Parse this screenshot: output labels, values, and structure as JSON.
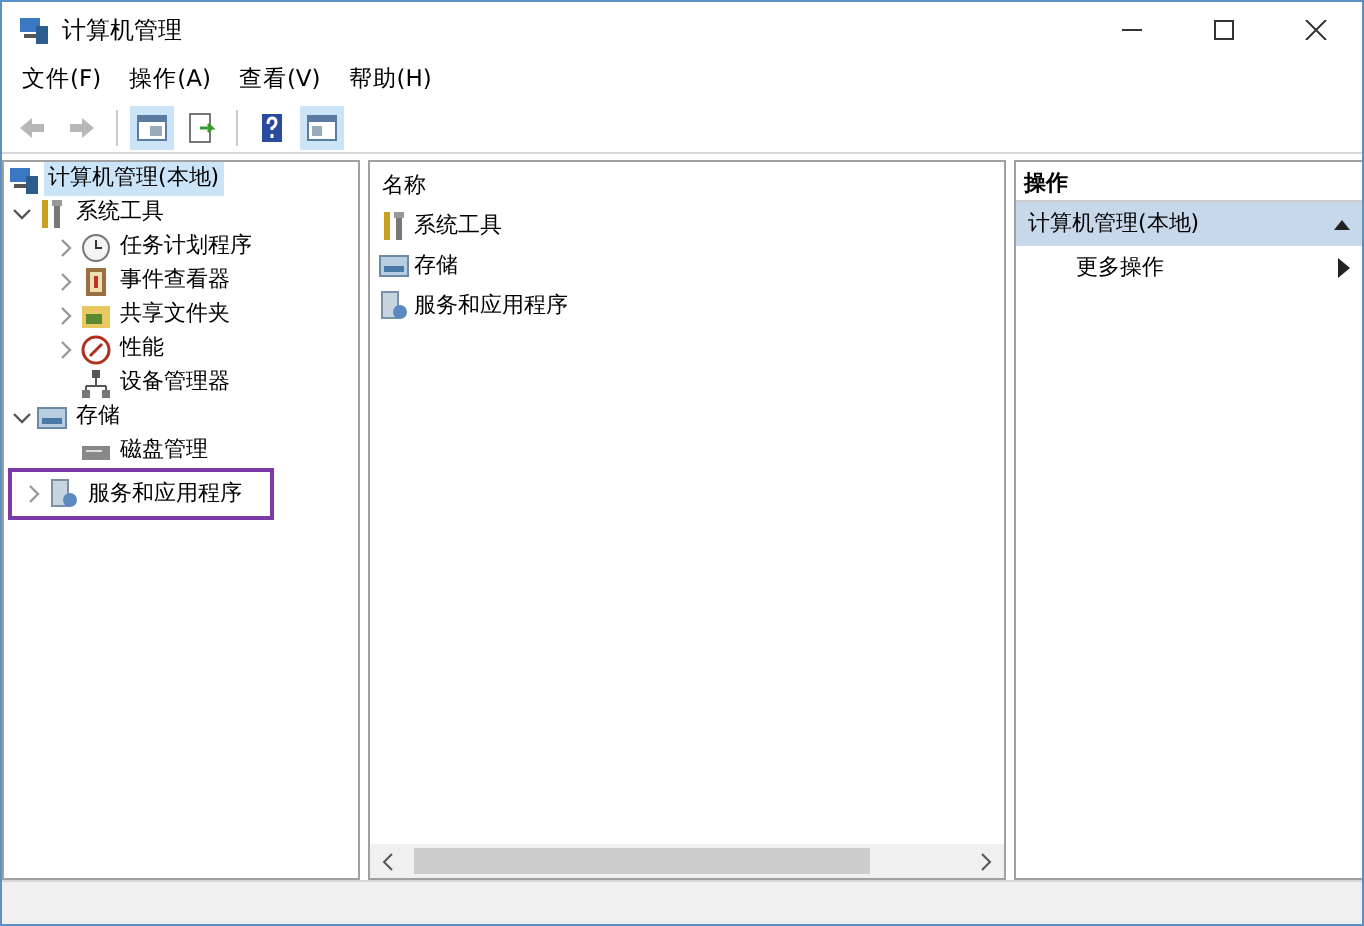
{
  "window": {
    "title": "计算机管理"
  },
  "menu": [
    "文件(F)",
    "操作(A)",
    "查看(V)",
    "帮助(H)"
  ],
  "toolbar": [
    {
      "kind": "back",
      "disabled": true
    },
    {
      "kind": "forward",
      "disabled": true
    },
    {
      "kind": "sep"
    },
    {
      "kind": "pane",
      "selected": true
    },
    {
      "kind": "export",
      "selected": false
    },
    {
      "kind": "sep"
    },
    {
      "kind": "help",
      "selected": false
    },
    {
      "kind": "pane2",
      "selected": true
    }
  ],
  "tree": [
    {
      "label": "计算机管理(本地)",
      "kind": "computer",
      "selected": true,
      "highlighted": false,
      "children": [
        {
          "label": "系统工具",
          "kind": "tools",
          "expanded": true,
          "selected": false,
          "highlighted": false,
          "children": [
            {
              "label": "任务计划程序",
              "kind": "clock",
              "expanded": false,
              "selected": false,
              "highlighted": false
            },
            {
              "label": "事件查看器",
              "kind": "event",
              "expanded": false,
              "selected": false,
              "highlighted": false
            },
            {
              "label": "共享文件夹",
              "kind": "share",
              "expanded": false,
              "selected": false,
              "highlighted": false
            },
            {
              "label": "性能",
              "kind": "perf",
              "expanded": false,
              "selected": false,
              "highlighted": false
            },
            {
              "label": "设备管理器",
              "kind": "device",
              "selected": false,
              "highlighted": false
            }
          ]
        },
        {
          "label": "存储",
          "kind": "storage",
          "expanded": true,
          "selected": false,
          "highlighted": false,
          "children": [
            {
              "label": "磁盘管理",
              "kind": "disk",
              "selected": false,
              "highlighted": false
            }
          ]
        },
        {
          "label": "服务和应用程序",
          "kind": "services",
          "expanded": false,
          "selected": false,
          "highlighted": true
        }
      ]
    }
  ],
  "list": {
    "column": "名称",
    "items": [
      {
        "label": "系统工具",
        "kind": "tools"
      },
      {
        "label": "存储",
        "kind": "storage"
      },
      {
        "label": "服务和应用程序",
        "kind": "services"
      }
    ]
  },
  "actions": {
    "header": "操作",
    "sections": [
      {
        "title": "计算机管理(本地)",
        "expanded": true,
        "items": [
          {
            "label": "更多操作"
          }
        ]
      }
    ]
  }
}
